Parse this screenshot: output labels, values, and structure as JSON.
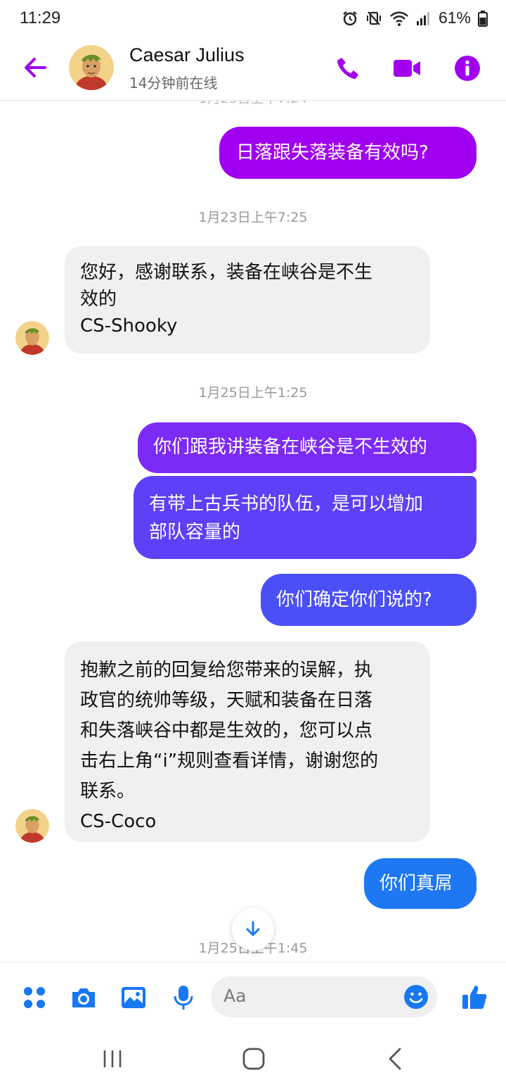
{
  "status_bar": {
    "time": "11:29",
    "battery": "61%"
  },
  "header": {
    "name": "Caesar Julius",
    "status": "14分钟前在线"
  },
  "messages": [
    {
      "kind": "sent",
      "text": "日落跟失落装备有效吗?"
    },
    {
      "kind": "timestamp",
      "text": "1月23日上午7:25"
    },
    {
      "kind": "received",
      "text": "您好，感谢联系，装备在峡谷是不生\n效的\nCS-Shooky"
    },
    {
      "kind": "timestamp",
      "text": "1月25日上午1:25"
    },
    {
      "kind": "sent",
      "text": "你们跟我讲装备在峡谷是不生效的"
    },
    {
      "kind": "sent",
      "text": "有带上古兵书的队伍，是可以增加\n部队容量的"
    },
    {
      "kind": "sent",
      "text": "你们确定你们说的?"
    },
    {
      "kind": "received",
      "text": "抱歉之前的回复给您带来的误解，执\n政官的统帅等级，天赋和装备在日落\n和失落峡谷中都是生效的，您可以点\n击右上角“i”规则查看详情，谢谢您的\n联系。\nCS-Coco"
    },
    {
      "kind": "sent",
      "text": "你们真屌"
    },
    {
      "kind": "timestamp",
      "text": "1月25日上午1:45"
    }
  ],
  "composer": {
    "placeholder": "Aa"
  },
  "colors": {
    "messenger_purple": "#a100f0",
    "sent_gradient": [
      "#a000ef",
      "#7c2af6",
      "#4b4ff8",
      "#1e78f3"
    ],
    "received_bg": "#f0f0f0"
  }
}
